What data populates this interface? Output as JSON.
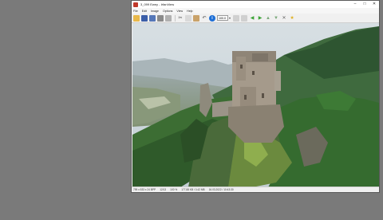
{
  "window": {
    "title": "3_099 Ewey - IrfanView",
    "minimize_glyph": "–",
    "maximize_glyph": "□",
    "close_glyph": "✕"
  },
  "menu": [
    "File",
    "Edit",
    "Image",
    "Options",
    "View",
    "Help"
  ],
  "toolbar": {
    "zoom_value": "100.0",
    "zoom_arrow": "▾",
    "icons": [
      "open-folder-icon",
      "save-icon",
      "save-as-icon",
      "print-icon",
      "delete-icon",
      "cut-icon",
      "copy-icon",
      "paste-icon",
      "undo-icon",
      "info-icon",
      "fit-icon",
      "actual-size-icon",
      "previous-icon",
      "next-icon",
      "up-icon",
      "down-icon",
      "settings-icon",
      "favorite-icon"
    ]
  },
  "status": {
    "dimensions": "799 x 533 x 24 BPP",
    "index": "12/13",
    "zoom": "100 %",
    "filesize": "177.88 KB / 0.42 MB",
    "datetime": "16.03.2022 / 10:43:30"
  },
  "colors": {
    "desktop": "#7a7a7a",
    "titlebar": "#ffffff",
    "accent_blue": "#1e6fd6",
    "green_arrow": "#3aa335",
    "folder": "#e8b84a"
  }
}
